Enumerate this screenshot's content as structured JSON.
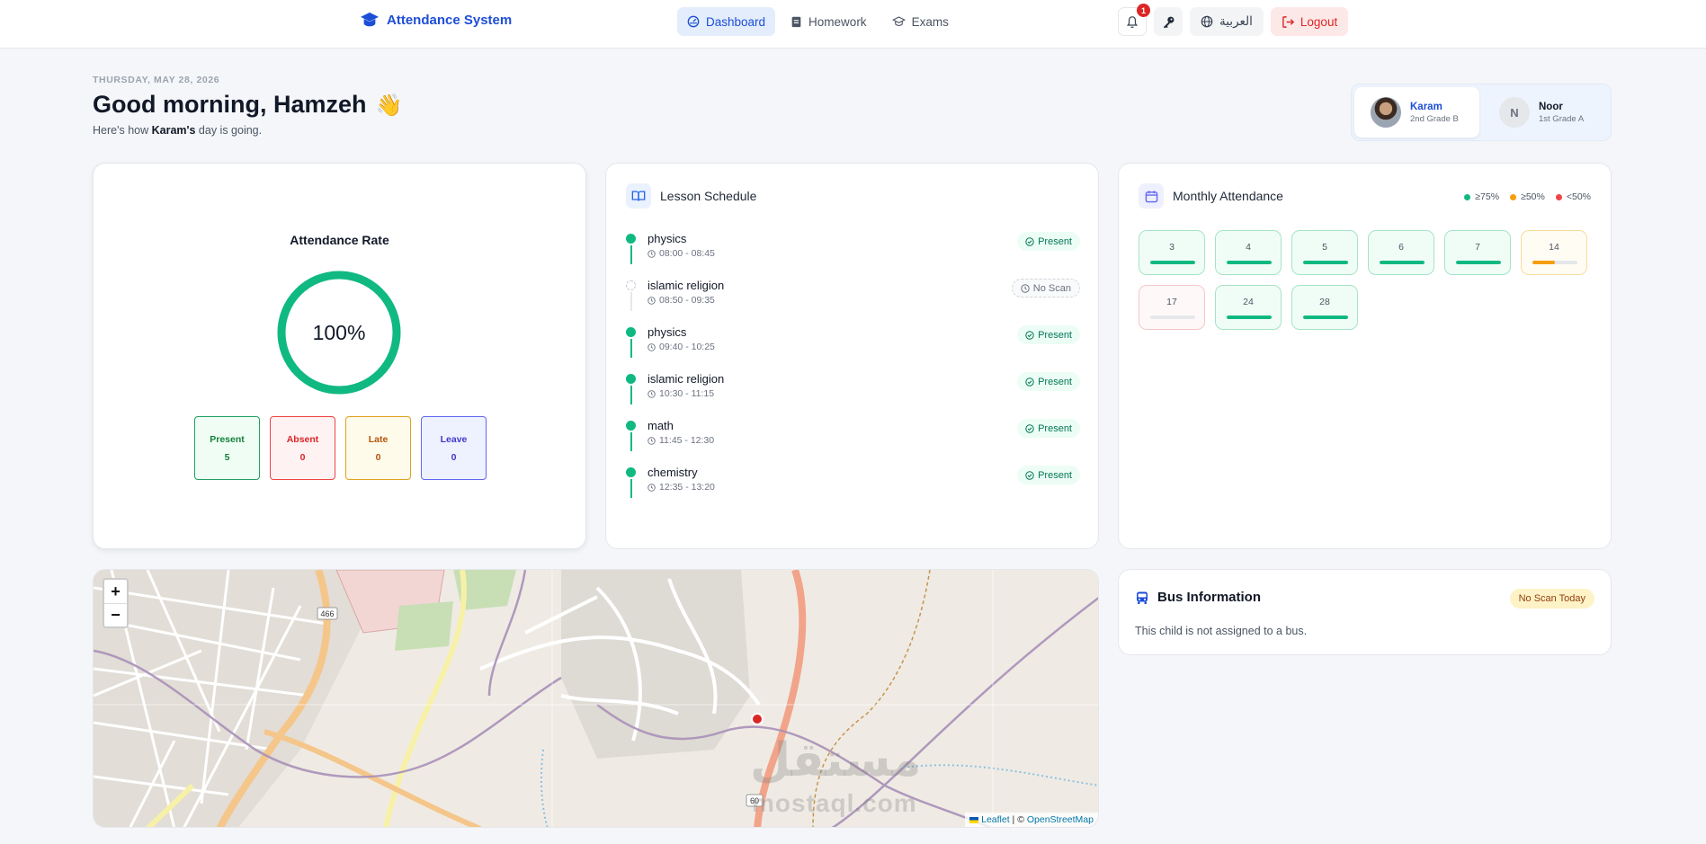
{
  "header": {
    "brand": "Attendance System",
    "nav": [
      {
        "label": "Dashboard",
        "icon": "dashboard-icon",
        "active": true
      },
      {
        "label": "Homework",
        "icon": "clipboard-icon",
        "active": false
      },
      {
        "label": "Exams",
        "icon": "graduation-cap-icon",
        "active": false
      }
    ],
    "notification_count": "1",
    "language_label": "العربية",
    "logout_label": "Logout"
  },
  "greeting": {
    "date": "THURSDAY, MAY 28, 2026",
    "title": "Good morning, Hamzeh",
    "emoji": "👋",
    "subtitle_prefix": "Here's how ",
    "child_name": "Karam's",
    "subtitle_suffix": " day is going."
  },
  "children": [
    {
      "name": "Karam",
      "grade": "2nd Grade B",
      "active": true
    },
    {
      "name": "Noor",
      "grade": "1st Grade A",
      "initial": "N",
      "active": false
    }
  ],
  "attendance": {
    "title": "Attendance Rate",
    "rate_label": "100%",
    "rate": 1.0,
    "stats": [
      {
        "label": "Present",
        "value": "5"
      },
      {
        "label": "Absent",
        "value": "0"
      },
      {
        "label": "Late",
        "value": "0"
      },
      {
        "label": "Leave",
        "value": "0"
      }
    ]
  },
  "schedule": {
    "title": "Lesson Schedule",
    "lessons": [
      {
        "name": "physics",
        "time": "08:00 - 08:45",
        "status": "Present"
      },
      {
        "name": "islamic religion",
        "time": "08:50 - 09:35",
        "status": "No Scan"
      },
      {
        "name": "physics",
        "time": "09:40 - 10:25",
        "status": "Present"
      },
      {
        "name": "islamic religion",
        "time": "10:30 - 11:15",
        "status": "Present"
      },
      {
        "name": "math",
        "time": "11:45 - 12:30",
        "status": "Present"
      },
      {
        "name": "chemistry",
        "time": "12:35 - 13:20",
        "status": "Present"
      }
    ]
  },
  "monthly": {
    "title": "Monthly Attendance",
    "legend": [
      {
        "label": "≥75%",
        "color": "#10b981"
      },
      {
        "label": "≥50%",
        "color": "#f59e0b"
      },
      {
        "label": "<50%",
        "color": "#ef4444"
      }
    ],
    "days": [
      {
        "day": "3",
        "level": 1.0
      },
      {
        "day": "4",
        "level": 1.0
      },
      {
        "day": "5",
        "level": 1.0
      },
      {
        "day": "6",
        "level": 1.0
      },
      {
        "day": "7",
        "level": 1.0
      },
      {
        "day": "14",
        "level": 0.5
      },
      {
        "day": "17",
        "level": 0.0
      },
      {
        "day": "24",
        "level": 1.0
      },
      {
        "day": "28",
        "level": 1.0
      }
    ]
  },
  "map": {
    "zoom_in": "+",
    "zoom_out": "−",
    "attribution_leaflet": "Leaflet",
    "attribution_sep": " | © ",
    "attribution_osm": "OpenStreetMap",
    "road_label": "466",
    "road_label_2": "60",
    "watermark": "مستقل",
    "watermark_latin": "mostaql.com"
  },
  "bus": {
    "title": "Bus Information",
    "status": "No Scan Today",
    "message": "This child is not assigned to a bus."
  },
  "colors": {
    "accent": "#1d4ed8",
    "success": "#10b981",
    "warning": "#f59e0b",
    "danger": "#ef4444"
  }
}
